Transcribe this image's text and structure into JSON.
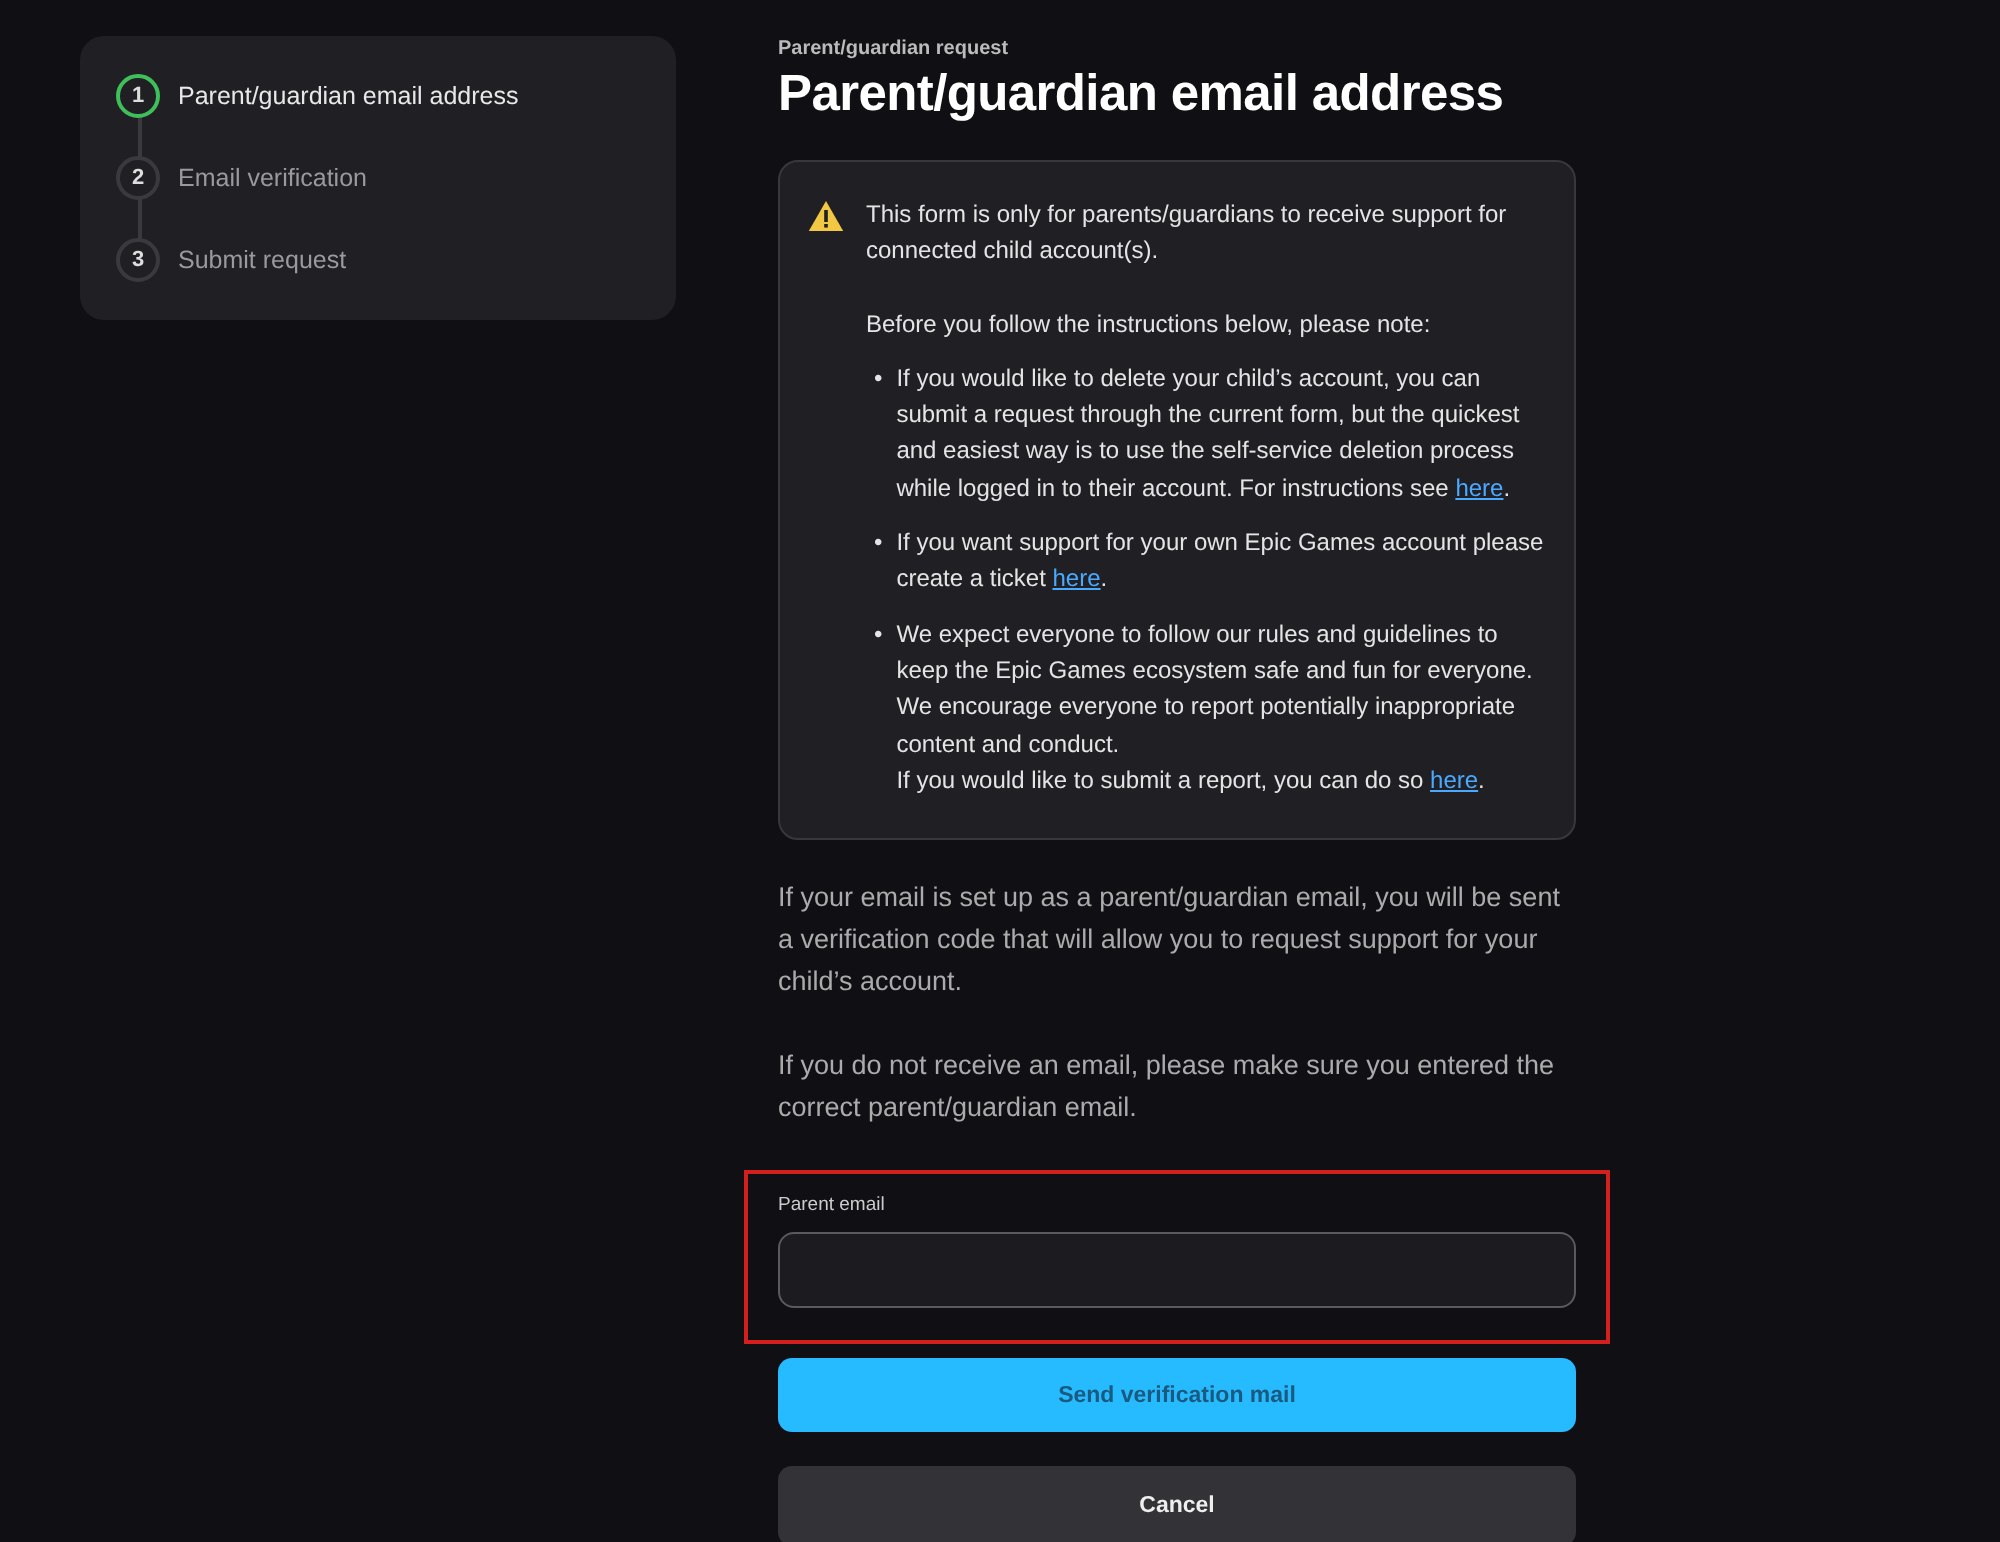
{
  "steps": [
    {
      "number": "1",
      "label": "Parent/guardian email address",
      "selected": true
    },
    {
      "number": "2",
      "label": "Email verification",
      "selected": false
    },
    {
      "number": "3",
      "label": "Submit request",
      "selected": false
    }
  ],
  "eyebrow": "Parent/guardian request",
  "heading": "Parent/guardian email address",
  "notice": {
    "intro": "This form is only for parents/guardians to receive support for connected child account(s).",
    "note": "Before you follow the instructions below, please note:",
    "bullets": [
      {
        "marker": "•",
        "lines": [
          {
            "text": "If you would like to delete your child’s account, you can submit a request through the current form, but the quickest and easiest way is to use the self-service deletion process while logged in to their account. For instructions see ",
            "link": "here",
            "after": "."
          }
        ]
      },
      {
        "marker": "•",
        "lines": [
          {
            "text": "If you want support for your own Epic Games account please create a ticket ",
            "link": "here",
            "after": "."
          }
        ]
      },
      {
        "marker": "•",
        "lines": [
          {
            "text": "We expect everyone to follow our rules and guidelines to keep the Epic Games ecosystem safe and fun for everyone. We encourage everyone to report potentially inappropriate content and conduct."
          },
          {
            "text": "If you would like to submit a report, you can do so ",
            "link": "here",
            "after": "."
          }
        ]
      }
    ]
  },
  "paragraphs": [
    "If your email is set up as a parent/guardian email, you will be sent a verification code that will allow you to request support for your child’s account.",
    "If you do not receive an email, please make sure you entered the correct parent/guardian email."
  ],
  "email_field": {
    "label": "Parent email",
    "highlighted": true
  },
  "buttons": [
    {
      "label": "Send verification mail",
      "kind": "primary"
    },
    {
      "label": "Cancel",
      "kind": "secondary"
    }
  ]
}
